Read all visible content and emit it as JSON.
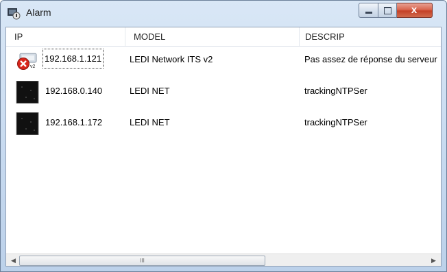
{
  "window": {
    "title": "Alarm",
    "close_label": "x"
  },
  "columns": {
    "ip": "IP",
    "model": "MODEL",
    "descrip": "DESCRIP"
  },
  "rows": [
    {
      "ip": "192.168.1.121",
      "model": "LEDI Network ITS v2",
      "descrip": "Pas assez de réponse du serveur",
      "icon": "device-error-icon"
    },
    {
      "ip": "192.168.0.140",
      "model": "LEDI NET",
      "descrip": "trackingNTPSer",
      "icon": "device-screen-icon"
    },
    {
      "ip": "192.168.1.172",
      "model": "LEDI NET",
      "descrip": "trackingNTPSer",
      "icon": "device-screen-icon"
    }
  ],
  "scrollbar": {
    "grip": "III"
  },
  "colors": {
    "error_red": "#d8261c",
    "close_button": "#c44127"
  }
}
